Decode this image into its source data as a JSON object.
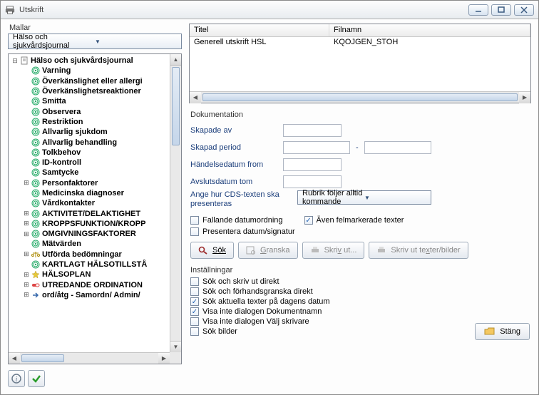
{
  "window": {
    "title": "Utskrift"
  },
  "left": {
    "label": "Mallar",
    "combo": "Hälso och sjukvårdsjournal",
    "tree": [
      {
        "expander": "-",
        "icon": "doc",
        "label": "Hälso och sjukvårdsjournal",
        "bold": true,
        "indent": 0
      },
      {
        "expander": "",
        "icon": "tgt",
        "label": "Varning",
        "bold": true,
        "indent": 1
      },
      {
        "expander": "",
        "icon": "tgt",
        "label": "Överkänslighet eller allergi",
        "bold": true,
        "indent": 1
      },
      {
        "expander": "",
        "icon": "tgt",
        "label": "Överkänslighetsreaktioner",
        "bold": true,
        "indent": 1
      },
      {
        "expander": "",
        "icon": "tgt",
        "label": "Smitta",
        "bold": true,
        "indent": 1
      },
      {
        "expander": "",
        "icon": "tgt",
        "label": "Observera",
        "bold": true,
        "indent": 1
      },
      {
        "expander": "",
        "icon": "tgt",
        "label": "Restriktion",
        "bold": true,
        "indent": 1
      },
      {
        "expander": "",
        "icon": "tgt",
        "label": "Allvarlig sjukdom",
        "bold": true,
        "indent": 1
      },
      {
        "expander": "",
        "icon": "tgt",
        "label": "Allvarlig behandling",
        "bold": true,
        "indent": 1
      },
      {
        "expander": "",
        "icon": "tgt",
        "label": "Tolkbehov",
        "bold": true,
        "indent": 1
      },
      {
        "expander": "",
        "icon": "tgt",
        "label": "ID-kontroll",
        "bold": true,
        "indent": 1
      },
      {
        "expander": "",
        "icon": "tgt",
        "label": "Samtycke",
        "bold": true,
        "indent": 1
      },
      {
        "expander": "+",
        "icon": "tgt",
        "label": "Personfaktorer",
        "bold": true,
        "indent": 1
      },
      {
        "expander": "",
        "icon": "tgt",
        "label": "Medicinska diagnoser",
        "bold": true,
        "indent": 1
      },
      {
        "expander": "",
        "icon": "tgt",
        "label": "Vårdkontakter",
        "bold": true,
        "indent": 1
      },
      {
        "expander": "+",
        "icon": "tgt",
        "label": "AKTIVITET/DELAKTIGHET",
        "bold": true,
        "indent": 1
      },
      {
        "expander": "+",
        "icon": "tgt",
        "label": "KROPPSFUNKTION/KROPP",
        "bold": true,
        "indent": 1
      },
      {
        "expander": "+",
        "icon": "tgt",
        "label": "OMGIVNINGSFAKTORER",
        "bold": true,
        "indent": 1
      },
      {
        "expander": "",
        "icon": "tgt",
        "label": "Mätvärden",
        "bold": true,
        "indent": 1
      },
      {
        "expander": "+",
        "icon": "scale",
        "label": "Utförda bedömningar",
        "bold": true,
        "indent": 1
      },
      {
        "expander": "",
        "icon": "tgt",
        "label": "KARTLAGT HÄLSOTILLSTÅ",
        "bold": true,
        "indent": 1
      },
      {
        "expander": "+",
        "icon": "star",
        "label": "HÄLSOPLAN",
        "bold": true,
        "indent": 1
      },
      {
        "expander": "+",
        "icon": "pill",
        "label": "UTREDANDE ORDINATION",
        "bold": true,
        "indent": 1
      },
      {
        "expander": "+",
        "icon": "arrow",
        "label": "ord/åtg - Samordn/ Admin/",
        "bold": true,
        "indent": 1
      }
    ]
  },
  "table": {
    "headers": [
      "Titel",
      "Filnamn"
    ],
    "rows": [
      [
        "Generell utskrift HSL",
        "KQOJGEN_STOH"
      ]
    ]
  },
  "doc": {
    "section": "Dokumentation",
    "skapade_av": "Skapade av",
    "skapad_period": "Skapad period",
    "handelsedatum": "Händelsedatum from",
    "avslutsdatum": "Avslutsdatum tom",
    "cds_label": "Ange hur CDS-texten ska presenteras",
    "cds_value": "Rubrik följer alltid kommande",
    "fallande": "Fallande datumordning",
    "aven": "Även felmarkerade texter",
    "presentera": "Presentera datum/signatur",
    "btn_sok": "Sök",
    "btn_granska": "Granska",
    "btn_skriv": "Skriv ut...",
    "btn_skriv_texter": "Skriv ut texter/bilder"
  },
  "settings": {
    "section": "Inställningar",
    "opt1": "Sök och skriv ut direkt",
    "opt2": "Sök och förhandsgranska direkt",
    "opt3": "Sök aktuella texter på dagens datum",
    "opt4": "Visa inte dialogen Dokumentnamn",
    "opt5": "Visa inte dialogen Välj skrivare",
    "opt6": "Sök bilder",
    "opt3_checked": true,
    "opt4_checked": true,
    "aven_checked": true
  },
  "close": "Stäng"
}
